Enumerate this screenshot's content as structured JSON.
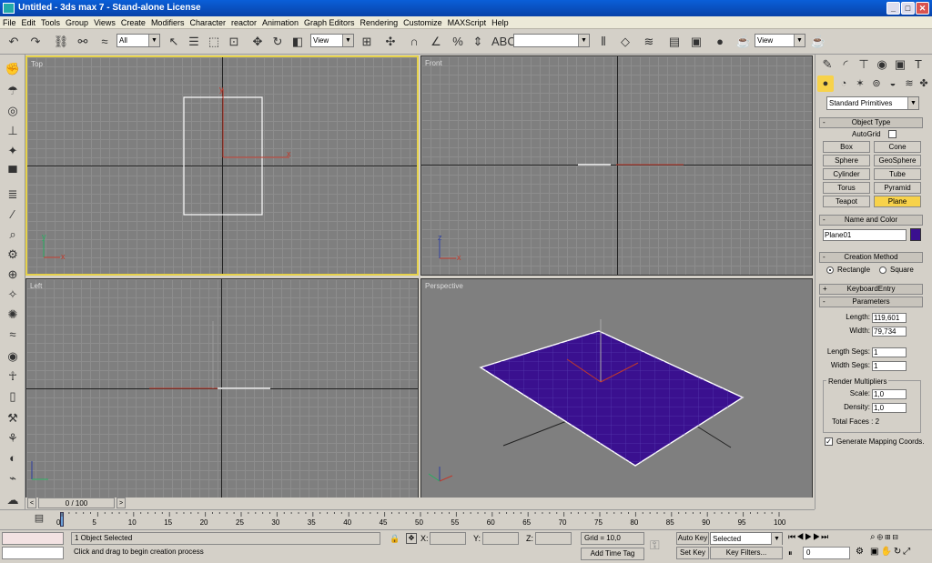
{
  "window": {
    "title": "Untitled - 3ds max 7 - Stand-alone License",
    "minimize": "_",
    "maximize": "□",
    "close": "✕"
  },
  "menu": [
    "File",
    "Edit",
    "Tools",
    "Group",
    "Views",
    "Create",
    "Modifiers",
    "Character",
    "reactor",
    "Animation",
    "Graph Editors",
    "Rendering",
    "Customize",
    "MAXScript",
    "Help"
  ],
  "toolbar": {
    "selection_filter": "All",
    "ref_coord": "View",
    "named_sel": "",
    "render_view": "View"
  },
  "viewports": {
    "top": "Top",
    "front": "Front",
    "left": "Left",
    "perspective": "Perspective"
  },
  "axis_labels": {
    "x": "x",
    "y": "y",
    "z": "z"
  },
  "colors": {
    "plane": "#3a108f",
    "active_border": "#e6d24a",
    "selected_btn": "#f7d24a",
    "x_axis": "#c0392b",
    "y_axis": "#27ae60",
    "z_axis": "#2c3e9f"
  },
  "command_panel": {
    "category": "Standard Primitives",
    "object_type": {
      "title": "Object Type",
      "autogrid": "AutoGrid",
      "buttons": [
        "Box",
        "Cone",
        "Sphere",
        "GeoSphere",
        "Cylinder",
        "Tube",
        "Torus",
        "Pyramid",
        "Teapot",
        "Plane"
      ],
      "selected": "Plane"
    },
    "name_color": {
      "title": "Name and Color",
      "name": "Plane01",
      "color": "#3a108f"
    },
    "creation_method": {
      "title": "Creation Method",
      "rectangle": "Rectangle",
      "square": "Square",
      "selected": "Rectangle"
    },
    "keyboard_entry": {
      "title": "KeyboardEntry"
    },
    "parameters": {
      "title": "Parameters",
      "length_label": "Length:",
      "length": "119,601",
      "width_label": "Width:",
      "width": "79,734",
      "length_segs_label": "Length Segs:",
      "length_segs": "1",
      "width_segs_label": "Width Segs:",
      "width_segs": "1",
      "render_mult": "Render Multipliers",
      "scale_label": "Scale:",
      "scale": "1,0",
      "density_label": "Density:",
      "density": "1,0",
      "total_faces": "Total Faces : 2",
      "gen_mapping": "Generate Mapping Coords."
    }
  },
  "time": {
    "slider": "0 / 100",
    "ticks": [
      "0",
      "5",
      "10",
      "15",
      "20",
      "25",
      "30",
      "35",
      "40",
      "45",
      "50",
      "55",
      "60",
      "65",
      "70",
      "75",
      "80",
      "85",
      "90",
      "95",
      "100"
    ]
  },
  "status": {
    "selected": "1 Object Selected",
    "prompt": "Click and drag to begin creation process",
    "x_label": "X:",
    "y_label": "Y:",
    "z_label": "Z:",
    "grid": "Grid = 10,0",
    "add_time_tag": "Add Time Tag",
    "auto_key": "Auto Key",
    "set_key": "Set Key",
    "key_mode": "Selected",
    "key_filters": "Key Filters...",
    "frame": "0"
  }
}
